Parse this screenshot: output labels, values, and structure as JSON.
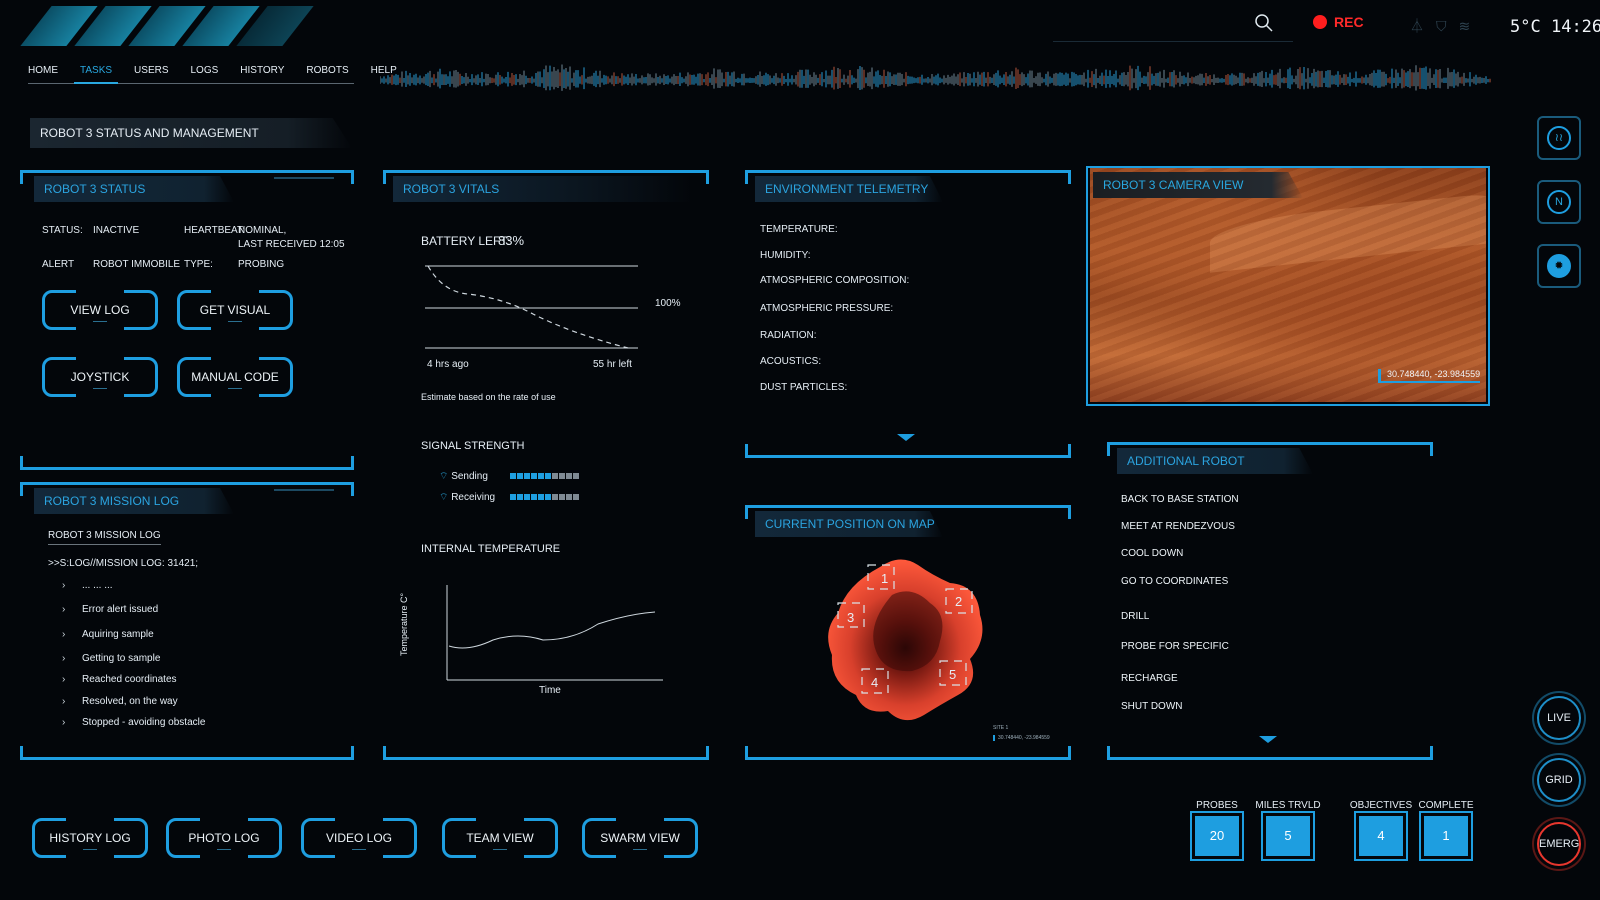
{
  "nav": {
    "items": [
      {
        "label": "HOME",
        "active": false
      },
      {
        "label": "TASKS",
        "active": true
      },
      {
        "label": "USERS",
        "active": false
      },
      {
        "label": "LOGS",
        "active": false
      },
      {
        "label": "HISTORY",
        "active": false
      },
      {
        "label": "ROBOTS",
        "active": false
      },
      {
        "label": "HELP",
        "active": false
      }
    ]
  },
  "topbar": {
    "rec_label": "REC",
    "weather": "5°C",
    "time": "14:26",
    "icons": [
      "search-icon",
      "antenna-icon",
      "satellite-icon",
      "rss-icon"
    ]
  },
  "page_title": "ROBOT 3 STATUS AND MANAGEMENT",
  "status_panel": {
    "title": "ROBOT 3 STATUS",
    "status_label": "STATUS:",
    "status_value": "INACTIVE",
    "heartbeat_label": "HEARTBEAT:",
    "heartbeat_value": "NOMINAL,",
    "heartbeat_sub": "LAST RECEIVED 12:05",
    "alert_label": "ALERT",
    "alert_value": "ROBOT IMMOBILE",
    "type_label": "TYPE:",
    "type_value": "PROBING",
    "buttons": {
      "view_log": "VIEW LOG",
      "get_visual": "GET VISUAL",
      "joystick": "JOYSTICK",
      "manual_code": "MANUAL CODE"
    }
  },
  "mission_log": {
    "title": "ROBOT 3 MISSION LOG",
    "heading": "ROBOT 3 MISSION LOG",
    "command": ">>S:LOG//MISSION LOG: 31421;",
    "entries": [
      "... ... ...",
      "Error alert issued",
      "Aquiring sample",
      "Getting to sample",
      "Reached coordinates",
      "Resolved, on the way",
      "Stopped - avoiding obstacle"
    ]
  },
  "vitals": {
    "title": "ROBOT 3 VITALS",
    "battery_label": "BATTERY LEFT:",
    "battery_value": "83%",
    "battery_chart": {
      "label_100": "100%",
      "left_label": "4 hrs ago",
      "right_label": "55 hr left",
      "note": "Estimate based on the rate of use"
    },
    "signal_title": "SIGNAL STRENGTH",
    "signal": [
      {
        "label": "Sending",
        "level": 0.6
      },
      {
        "label": "Receiving",
        "level": 0.6
      }
    ],
    "temp_title": "INTERNAL TEMPERATURE",
    "temp_ylabel": "Temperature C°",
    "temp_xlabel": "Time"
  },
  "environment": {
    "title": "ENVIRONMENT TELEMETRY",
    "rows": [
      "TEMPERATURE:",
      "HUMIDITY:",
      "ATMOSPHERIC COMPOSITION:",
      "ATMOSPHERIC PRESSURE:",
      "RADIATION:",
      "ACOUSTICS:",
      "DUST PARTICLES:"
    ]
  },
  "map": {
    "title": "CURRENT POSITION ON MAP",
    "sites": [
      "1",
      "2",
      "3",
      "4",
      "5"
    ],
    "footer_site": "SITE 1",
    "footer_coords": "30.748440, -23.984559"
  },
  "camera": {
    "title": "ROBOT 3 CAMERA VIEW",
    "coords": "30.748440, -23.984559"
  },
  "controls": {
    "title": "ADDITIONAL ROBOT CONTROLS",
    "items": [
      "BACK TO BASE STATION",
      "MEET AT RENDEZVOUS",
      "COOL DOWN",
      "GO TO COORDINATES",
      "DRILL",
      "PROBE  FOR SPECIFIC",
      "RECHARGE",
      "SHUT DOWN"
    ]
  },
  "bottom_buttons": {
    "history_log": "HISTORY LOG",
    "photo_log": "PHOTO LOG",
    "video_log": "VIDEO LOG",
    "team_view": "TEAM VIEW",
    "swarm_view": "SWARM VIEW"
  },
  "stats": [
    {
      "label": "PROBES",
      "value": "20"
    },
    {
      "label": "MILES TRVLD",
      "value": "5"
    },
    {
      "label": "OBJECTIVES",
      "value": "4"
    },
    {
      "label": "COMPLETE",
      "value": "1"
    }
  ],
  "side_buttons": {
    "live": "LIVE",
    "grid": "GRID",
    "emerg": "EMERG",
    "compass": "N"
  },
  "colors": {
    "accent": "#1e9ee0",
    "alert": "#e8372e",
    "background": "#03060a"
  }
}
